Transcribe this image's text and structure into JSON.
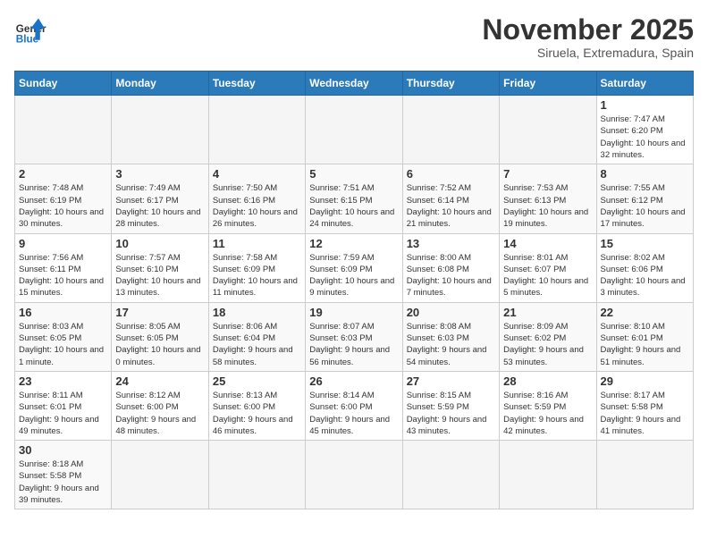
{
  "header": {
    "logo_line1": "General",
    "logo_line2": "Blue",
    "month": "November 2025",
    "location": "Siruela, Extremadura, Spain"
  },
  "weekdays": [
    "Sunday",
    "Monday",
    "Tuesday",
    "Wednesday",
    "Thursday",
    "Friday",
    "Saturday"
  ],
  "weeks": [
    [
      {
        "day": "",
        "sunrise": "",
        "sunset": "",
        "daylight": "",
        "empty": true
      },
      {
        "day": "",
        "sunrise": "",
        "sunset": "",
        "daylight": "",
        "empty": true
      },
      {
        "day": "",
        "sunrise": "",
        "sunset": "",
        "daylight": "",
        "empty": true
      },
      {
        "day": "",
        "sunrise": "",
        "sunset": "",
        "daylight": "",
        "empty": true
      },
      {
        "day": "",
        "sunrise": "",
        "sunset": "",
        "daylight": "",
        "empty": true
      },
      {
        "day": "",
        "sunrise": "",
        "sunset": "",
        "daylight": "",
        "empty": true
      },
      {
        "day": "1",
        "sunrise": "Sunrise: 7:47 AM",
        "sunset": "Sunset: 6:20 PM",
        "daylight": "Daylight: 10 hours and 32 minutes.",
        "empty": false
      }
    ],
    [
      {
        "day": "2",
        "sunrise": "Sunrise: 7:48 AM",
        "sunset": "Sunset: 6:19 PM",
        "daylight": "Daylight: 10 hours and 30 minutes.",
        "empty": false
      },
      {
        "day": "3",
        "sunrise": "Sunrise: 7:49 AM",
        "sunset": "Sunset: 6:17 PM",
        "daylight": "Daylight: 10 hours and 28 minutes.",
        "empty": false
      },
      {
        "day": "4",
        "sunrise": "Sunrise: 7:50 AM",
        "sunset": "Sunset: 6:16 PM",
        "daylight": "Daylight: 10 hours and 26 minutes.",
        "empty": false
      },
      {
        "day": "5",
        "sunrise": "Sunrise: 7:51 AM",
        "sunset": "Sunset: 6:15 PM",
        "daylight": "Daylight: 10 hours and 24 minutes.",
        "empty": false
      },
      {
        "day": "6",
        "sunrise": "Sunrise: 7:52 AM",
        "sunset": "Sunset: 6:14 PM",
        "daylight": "Daylight: 10 hours and 21 minutes.",
        "empty": false
      },
      {
        "day": "7",
        "sunrise": "Sunrise: 7:53 AM",
        "sunset": "Sunset: 6:13 PM",
        "daylight": "Daylight: 10 hours and 19 minutes.",
        "empty": false
      },
      {
        "day": "8",
        "sunrise": "Sunrise: 7:55 AM",
        "sunset": "Sunset: 6:12 PM",
        "daylight": "Daylight: 10 hours and 17 minutes.",
        "empty": false
      }
    ],
    [
      {
        "day": "9",
        "sunrise": "Sunrise: 7:56 AM",
        "sunset": "Sunset: 6:11 PM",
        "daylight": "Daylight: 10 hours and 15 minutes.",
        "empty": false
      },
      {
        "day": "10",
        "sunrise": "Sunrise: 7:57 AM",
        "sunset": "Sunset: 6:10 PM",
        "daylight": "Daylight: 10 hours and 13 minutes.",
        "empty": false
      },
      {
        "day": "11",
        "sunrise": "Sunrise: 7:58 AM",
        "sunset": "Sunset: 6:09 PM",
        "daylight": "Daylight: 10 hours and 11 minutes.",
        "empty": false
      },
      {
        "day": "12",
        "sunrise": "Sunrise: 7:59 AM",
        "sunset": "Sunset: 6:09 PM",
        "daylight": "Daylight: 10 hours and 9 minutes.",
        "empty": false
      },
      {
        "day": "13",
        "sunrise": "Sunrise: 8:00 AM",
        "sunset": "Sunset: 6:08 PM",
        "daylight": "Daylight: 10 hours and 7 minutes.",
        "empty": false
      },
      {
        "day": "14",
        "sunrise": "Sunrise: 8:01 AM",
        "sunset": "Sunset: 6:07 PM",
        "daylight": "Daylight: 10 hours and 5 minutes.",
        "empty": false
      },
      {
        "day": "15",
        "sunrise": "Sunrise: 8:02 AM",
        "sunset": "Sunset: 6:06 PM",
        "daylight": "Daylight: 10 hours and 3 minutes.",
        "empty": false
      }
    ],
    [
      {
        "day": "16",
        "sunrise": "Sunrise: 8:03 AM",
        "sunset": "Sunset: 6:05 PM",
        "daylight": "Daylight: 10 hours and 1 minute.",
        "empty": false
      },
      {
        "day": "17",
        "sunrise": "Sunrise: 8:05 AM",
        "sunset": "Sunset: 6:05 PM",
        "daylight": "Daylight: 10 hours and 0 minutes.",
        "empty": false
      },
      {
        "day": "18",
        "sunrise": "Sunrise: 8:06 AM",
        "sunset": "Sunset: 6:04 PM",
        "daylight": "Daylight: 9 hours and 58 minutes.",
        "empty": false
      },
      {
        "day": "19",
        "sunrise": "Sunrise: 8:07 AM",
        "sunset": "Sunset: 6:03 PM",
        "daylight": "Daylight: 9 hours and 56 minutes.",
        "empty": false
      },
      {
        "day": "20",
        "sunrise": "Sunrise: 8:08 AM",
        "sunset": "Sunset: 6:03 PM",
        "daylight": "Daylight: 9 hours and 54 minutes.",
        "empty": false
      },
      {
        "day": "21",
        "sunrise": "Sunrise: 8:09 AM",
        "sunset": "Sunset: 6:02 PM",
        "daylight": "Daylight: 9 hours and 53 minutes.",
        "empty": false
      },
      {
        "day": "22",
        "sunrise": "Sunrise: 8:10 AM",
        "sunset": "Sunset: 6:01 PM",
        "daylight": "Daylight: 9 hours and 51 minutes.",
        "empty": false
      }
    ],
    [
      {
        "day": "23",
        "sunrise": "Sunrise: 8:11 AM",
        "sunset": "Sunset: 6:01 PM",
        "daylight": "Daylight: 9 hours and 49 minutes.",
        "empty": false
      },
      {
        "day": "24",
        "sunrise": "Sunrise: 8:12 AM",
        "sunset": "Sunset: 6:00 PM",
        "daylight": "Daylight: 9 hours and 48 minutes.",
        "empty": false
      },
      {
        "day": "25",
        "sunrise": "Sunrise: 8:13 AM",
        "sunset": "Sunset: 6:00 PM",
        "daylight": "Daylight: 9 hours and 46 minutes.",
        "empty": false
      },
      {
        "day": "26",
        "sunrise": "Sunrise: 8:14 AM",
        "sunset": "Sunset: 6:00 PM",
        "daylight": "Daylight: 9 hours and 45 minutes.",
        "empty": false
      },
      {
        "day": "27",
        "sunrise": "Sunrise: 8:15 AM",
        "sunset": "Sunset: 5:59 PM",
        "daylight": "Daylight: 9 hours and 43 minutes.",
        "empty": false
      },
      {
        "day": "28",
        "sunrise": "Sunrise: 8:16 AM",
        "sunset": "Sunset: 5:59 PM",
        "daylight": "Daylight: 9 hours and 42 minutes.",
        "empty": false
      },
      {
        "day": "29",
        "sunrise": "Sunrise: 8:17 AM",
        "sunset": "Sunset: 5:58 PM",
        "daylight": "Daylight: 9 hours and 41 minutes.",
        "empty": false
      }
    ],
    [
      {
        "day": "30",
        "sunrise": "Sunrise: 8:18 AM",
        "sunset": "Sunset: 5:58 PM",
        "daylight": "Daylight: 9 hours and 39 minutes.",
        "empty": false
      },
      {
        "day": "",
        "sunrise": "",
        "sunset": "",
        "daylight": "",
        "empty": true
      },
      {
        "day": "",
        "sunrise": "",
        "sunset": "",
        "daylight": "",
        "empty": true
      },
      {
        "day": "",
        "sunrise": "",
        "sunset": "",
        "daylight": "",
        "empty": true
      },
      {
        "day": "",
        "sunrise": "",
        "sunset": "",
        "daylight": "",
        "empty": true
      },
      {
        "day": "",
        "sunrise": "",
        "sunset": "",
        "daylight": "",
        "empty": true
      },
      {
        "day": "",
        "sunrise": "",
        "sunset": "",
        "daylight": "",
        "empty": true
      }
    ]
  ]
}
